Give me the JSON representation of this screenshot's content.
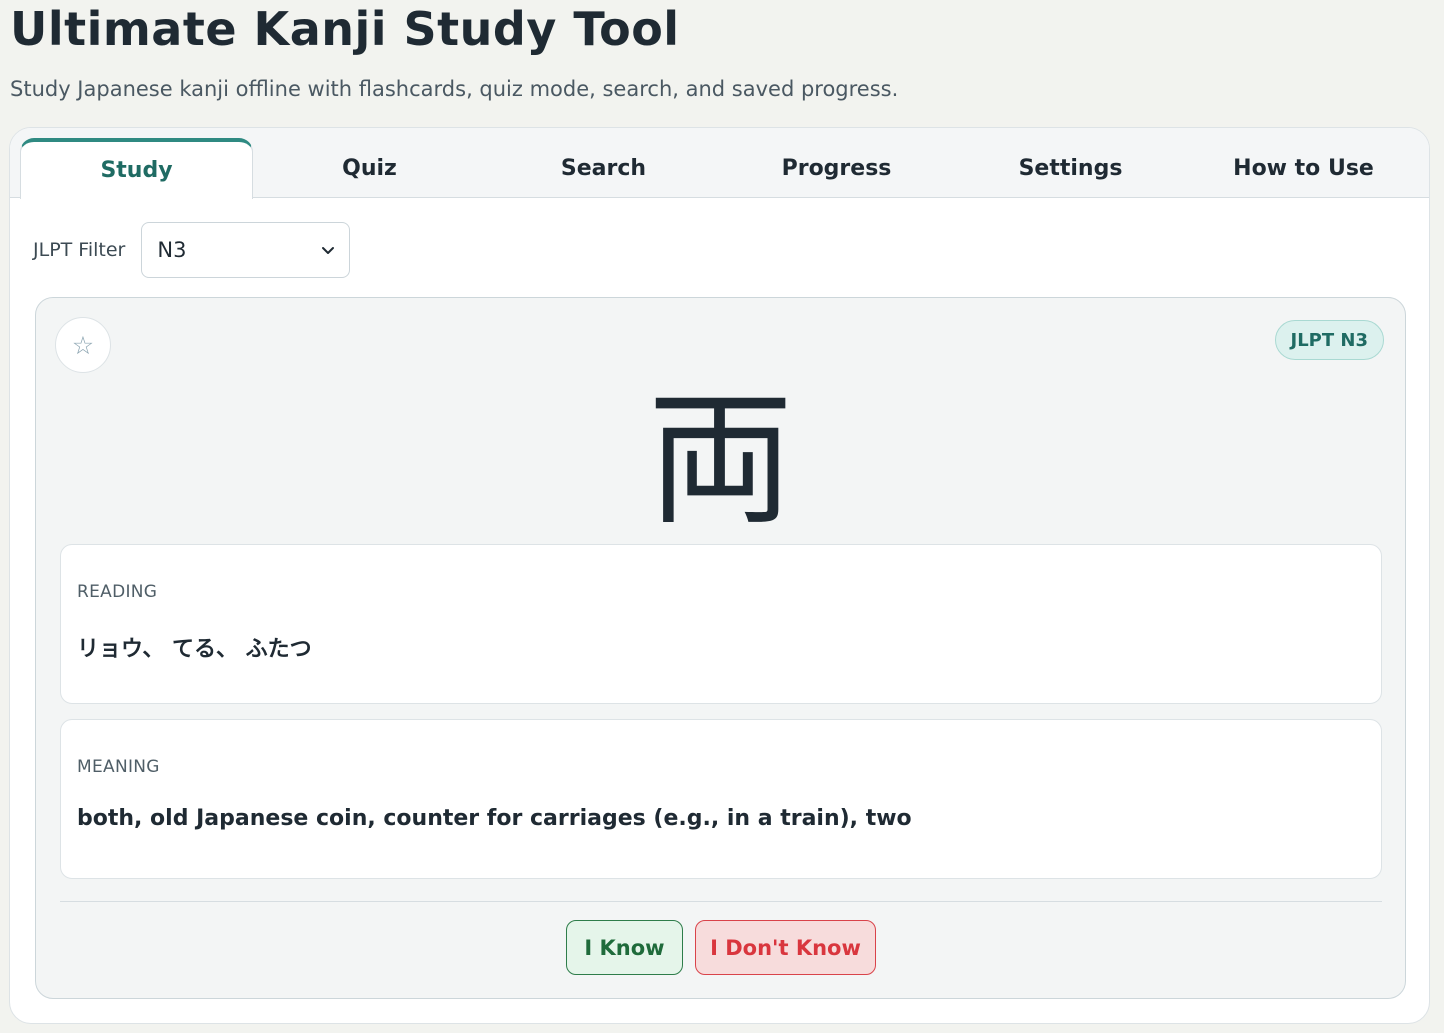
{
  "header": {
    "title": "Ultimate Kanji Study Tool",
    "subtitle": "Study Japanese kanji offline with flashcards, quiz mode, search, and saved progress."
  },
  "tabs": [
    {
      "label": "Study",
      "active": true
    },
    {
      "label": "Quiz",
      "active": false
    },
    {
      "label": "Search",
      "active": false
    },
    {
      "label": "Progress",
      "active": false
    },
    {
      "label": "Settings",
      "active": false
    },
    {
      "label": "How to Use",
      "active": false
    }
  ],
  "filter": {
    "label": "JLPT Filter",
    "selected": "N3"
  },
  "card": {
    "favorite_icon": "star-outline-icon",
    "level_badge": "JLPT N3",
    "kanji": "両",
    "reading_label": "READING",
    "reading": "リョウ、 てる、 ふたつ",
    "meaning_label": "MEANING",
    "meaning": "both, old Japanese coin, counter for carriages (e.g., in a train), two"
  },
  "actions": {
    "know_label": "I Know",
    "dont_know_label": "I Don't Know"
  },
  "colors": {
    "accent": "#2f8a82",
    "know": "#1f6b3b",
    "dont_know": "#d9363e"
  }
}
